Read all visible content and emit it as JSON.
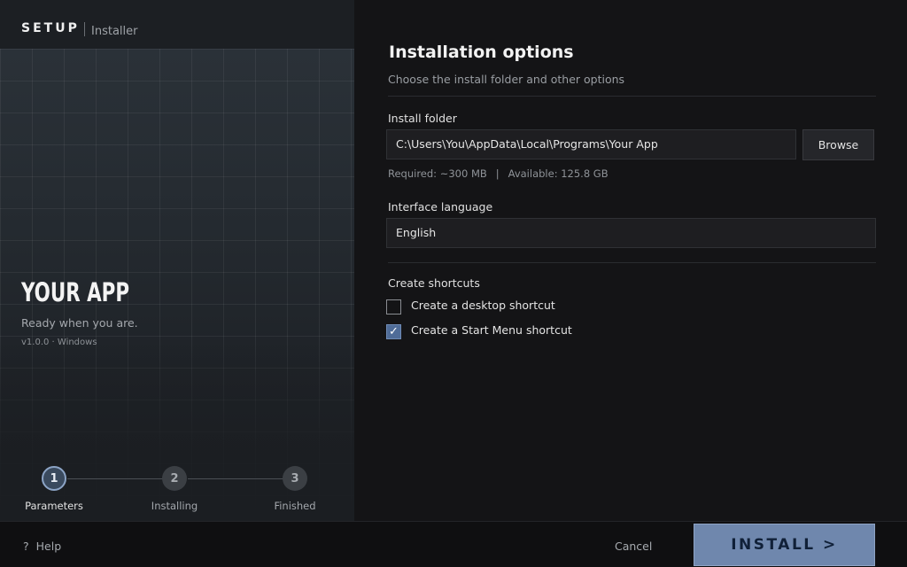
{
  "header": {
    "brand": "SETUP",
    "subtitle": "Installer"
  },
  "app": {
    "name": "YOUR APP",
    "tagline": "Ready when you are.",
    "version": "v1.0.0 · Windows"
  },
  "steps": [
    {
      "number": "1",
      "label": "Parameters",
      "active": true
    },
    {
      "number": "2",
      "label": "Installing",
      "active": false
    },
    {
      "number": "3",
      "label": "Finished",
      "active": false
    }
  ],
  "main": {
    "title": "Installation options",
    "subtitle": "Choose the install folder and other options",
    "install_folder": {
      "label": "Install folder",
      "value": "C:\\Users\\You\\AppData\\Local\\Programs\\Your App",
      "browse_label": "Browse",
      "required": "Required: ~300 MB",
      "separator": "|",
      "available": "Available: 125.8 GB"
    },
    "language": {
      "label": "Interface language",
      "value": "English"
    },
    "shortcuts": {
      "label": "Create shortcuts",
      "items": [
        {
          "label": "Create a desktop shortcut",
          "checked": false
        },
        {
          "label": "Create a Start Menu shortcut",
          "checked": true
        }
      ]
    }
  },
  "footer": {
    "help_icon": "?",
    "help_label": "Help",
    "cancel_label": "Cancel",
    "install_label": "INSTALL  >"
  },
  "colors": {
    "accent": "#6f87ad",
    "checkbox_checked": "#4f6c98"
  },
  "icons": {
    "help": "question-icon",
    "check": "checkmark-icon"
  }
}
